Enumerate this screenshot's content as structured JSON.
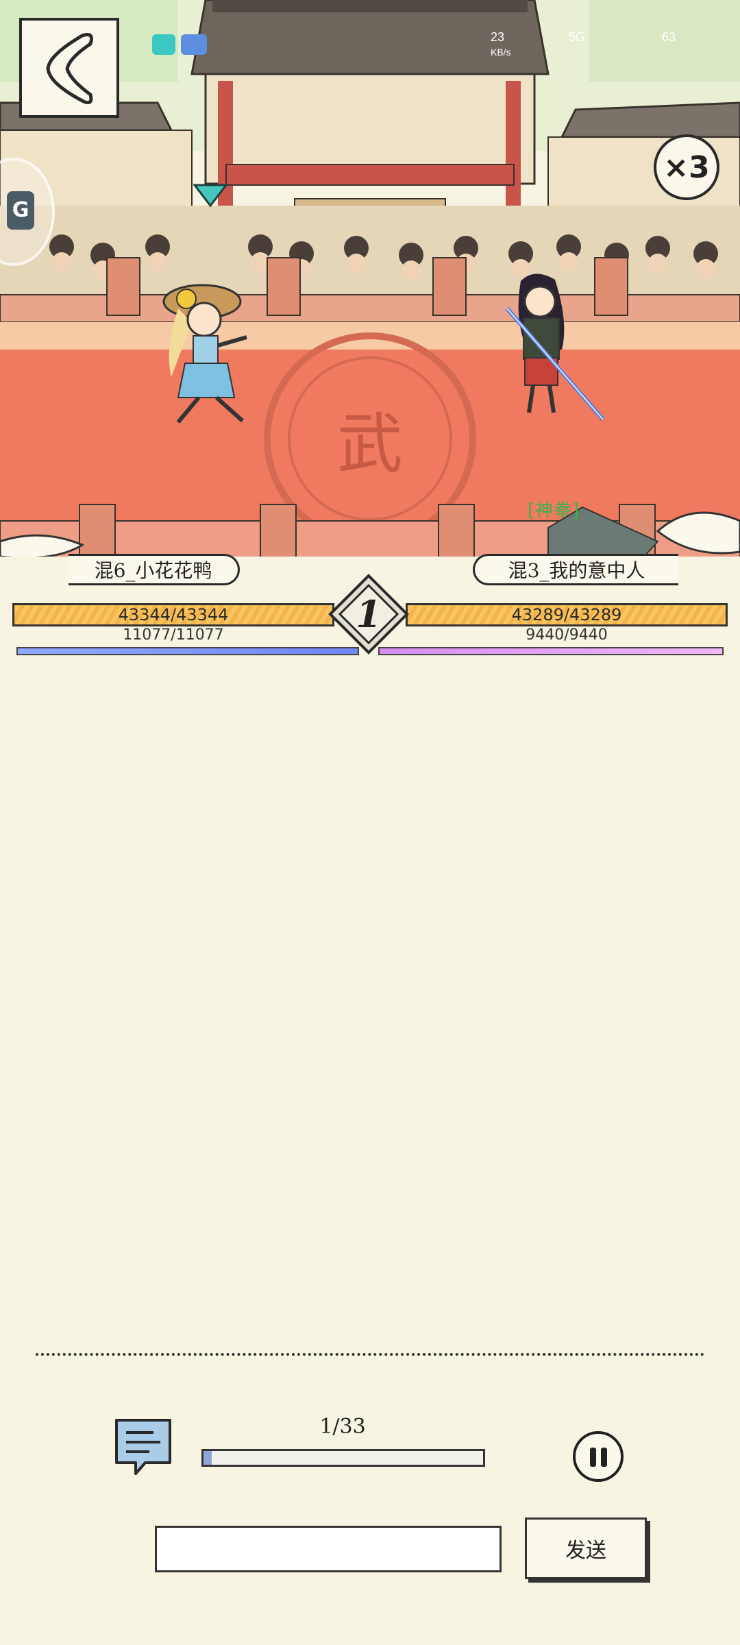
{
  "status_bar": {
    "speed_value": "23",
    "speed_unit": "KB/s",
    "network": "5G",
    "battery": "63",
    "app_icons": [
      "taptap-icon",
      "app-icon"
    ]
  },
  "arena": {
    "floor_character": "武",
    "skill_label": "[神拳]",
    "speed_multiplier": "×3"
  },
  "player_left": {
    "name": "混6_小花花鸭",
    "hp": "43344/43344",
    "mp": "11077/11077"
  },
  "player_right": {
    "name": "混3_我的意中人",
    "hp": "43289/43289",
    "mp": "9440/9440"
  },
  "round": "1",
  "controls": {
    "progress_label": "1/33",
    "progress_fraction": 0.0303,
    "message_placeholder": "",
    "send_label": "发送"
  }
}
